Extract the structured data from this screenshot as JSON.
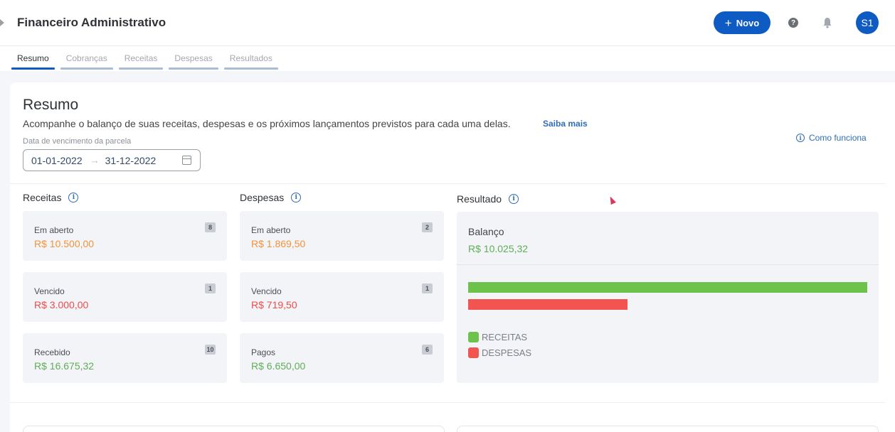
{
  "header": {
    "title": "Financeiro Administrativo",
    "new_button": "Novo",
    "avatar": "S1"
  },
  "tabs": [
    {
      "label": "Resumo",
      "active": true
    },
    {
      "label": "Cobranças",
      "active": false
    },
    {
      "label": "Receitas",
      "active": false
    },
    {
      "label": "Despesas",
      "active": false
    },
    {
      "label": "Resultados",
      "active": false
    }
  ],
  "summary": {
    "title": "Resumo",
    "description": "Acompanhe o balanço de suas receitas, despesas e os próximos lançamentos previstos para cada uma delas.",
    "learn_more": "Saiba mais",
    "how_it_works": "Como funciona",
    "date_label": "Data de vencimento da parcela",
    "date_start": "01-01-2022",
    "date_end": "31-12-2022"
  },
  "receitas": {
    "title": "Receitas",
    "items": [
      {
        "label": "Em aberto",
        "value": "R$ 10.500,00",
        "count": "8",
        "color": "#f2933a"
      },
      {
        "label": "Vencido",
        "value": "R$ 3.000,00",
        "count": "1",
        "color": "#ee4b4b"
      },
      {
        "label": "Recebido",
        "value": "R$ 16.675,32",
        "count": "10",
        "color": "#5fae57"
      }
    ]
  },
  "despesas": {
    "title": "Despesas",
    "items": [
      {
        "label": "Em aberto",
        "value": "R$ 1.869,50",
        "count": "2",
        "color": "#f2933a"
      },
      {
        "label": "Vencido",
        "value": "R$ 719,50",
        "count": "1",
        "color": "#ee4b4b"
      },
      {
        "label": "Pagos",
        "value": "R$ 6.650,00",
        "count": "6",
        "color": "#5fae57"
      }
    ]
  },
  "resultado": {
    "title": "Resultado",
    "balance_label": "Balanço",
    "balance_value": "R$ 10.025,32",
    "legend": [
      {
        "label": "RECEITAS",
        "color": "#6cc24a"
      },
      {
        "label": "DESPESAS",
        "color": "#f25450"
      }
    ]
  },
  "chart_data": {
    "type": "bar",
    "orientation": "horizontal",
    "categories": [
      "RECEITAS",
      "DESPESAS"
    ],
    "values": [
      16675.32,
      6650.0
    ],
    "colors": [
      "#6cc24a",
      "#f25450"
    ]
  },
  "icons": {
    "help": "?",
    "info": "i",
    "plus": "+",
    "arrow": "→"
  }
}
